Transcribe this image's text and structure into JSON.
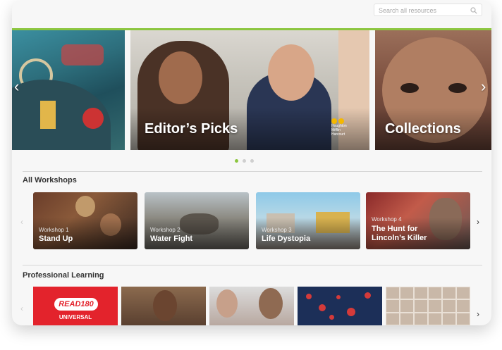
{
  "search": {
    "placeholder": "Search all resources"
  },
  "hero": {
    "slides": [
      {
        "title": ""
      },
      {
        "title": "Editor’s Picks",
        "logo_lines": [
          "Houghton",
          "Mifflin",
          "Harcourt"
        ]
      },
      {
        "title": "Collections"
      }
    ],
    "prev_icon": "chevron-left-icon",
    "next_icon": "chevron-right-icon",
    "pagination": {
      "count": 3,
      "active_index": 0,
      "active_color": "#8cc63f"
    }
  },
  "workshops": {
    "heading": "All Workshops",
    "items": [
      {
        "subtitle": "Workshop 1",
        "title_lines": [
          "Stand Up"
        ]
      },
      {
        "subtitle": "Workshop 2",
        "title_lines": [
          "Water Fight"
        ]
      },
      {
        "subtitle": "Workshop 3",
        "title_lines": [
          "Life Dystopia"
        ]
      },
      {
        "subtitle": "Workshop 4",
        "title_lines": [
          "The Hunt for",
          "Lincoln’s Killer"
        ]
      }
    ]
  },
  "professional_learning": {
    "heading": "Professional Learning",
    "read180": {
      "logo": "READ180",
      "label": "UNIVERSAL"
    }
  },
  "colors": {
    "accent": "#8cc63f",
    "read180_red": "#e3232c"
  },
  "arrows": {
    "left": "‹",
    "right": "›"
  }
}
